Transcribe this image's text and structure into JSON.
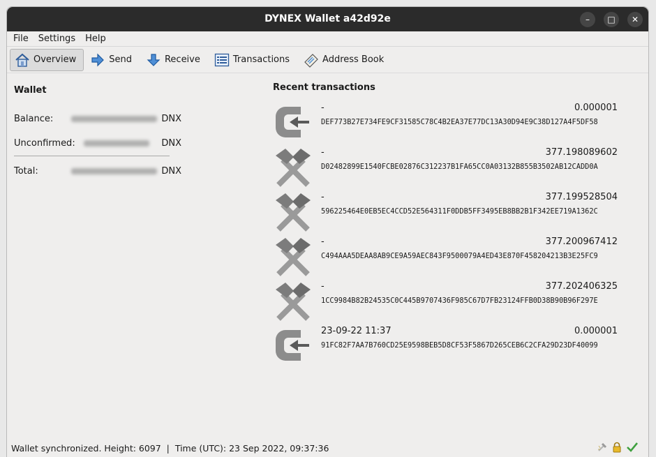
{
  "window": {
    "title": "DYNEX Wallet a42d92e",
    "controls": [
      "–",
      "□",
      "✕"
    ]
  },
  "menu": {
    "items": [
      "File",
      "Settings",
      "Help"
    ]
  },
  "toolbar": {
    "items": [
      {
        "label": "Overview",
        "icon": "home-icon",
        "active": true
      },
      {
        "label": "Send",
        "icon": "send-arrow-icon",
        "active": false
      },
      {
        "label": "Receive",
        "icon": "receive-arrow-icon",
        "active": false
      },
      {
        "label": "Transactions",
        "icon": "list-icon",
        "active": false
      },
      {
        "label": "Address Book",
        "icon": "address-book-icon",
        "active": false
      }
    ]
  },
  "wallet": {
    "heading": "Wallet",
    "balance_label": "Balance:",
    "unconfirmed_label": "Unconfirmed:",
    "total_label": "Total:",
    "unit": "DNX"
  },
  "recent": {
    "heading": "Recent transactions",
    "transactions": [
      {
        "type": "incoming",
        "icon": "incoming-icon",
        "date": "-",
        "amount": "0.000001",
        "hash": "DEF773B27E734FE9CF31585C78C4B2EA37E77DC13A30D94E9C38D127A4F5DF58"
      },
      {
        "type": "mined",
        "icon": "mining-icon",
        "date": "-",
        "amount": "377.198089602",
        "hash": "D02482899E1540FCBE02876C312237B1FA65CC0A03132B855B3502AB12CADD0A"
      },
      {
        "type": "mined",
        "icon": "mining-icon",
        "date": "-",
        "amount": "377.199528504",
        "hash": "596225464E0EB5EC4CCD52E564311F0DDB5FF3495EB8BB2B1F342EE719A1362C"
      },
      {
        "type": "mined",
        "icon": "mining-icon",
        "date": "-",
        "amount": "377.200967412",
        "hash": "C494AAA5DEAA8AB9CE9A59AEC843F9500079A4ED43E870F458204213B3E25FC9"
      },
      {
        "type": "mined",
        "icon": "mining-icon",
        "date": "-",
        "amount": "377.202406325",
        "hash": "1CC9984B82B24535C0C445B9707436F985C67D7FB23124FFB0D38B90B96F297E"
      },
      {
        "type": "incoming",
        "icon": "incoming-icon",
        "date": "23-09-22 11:37",
        "amount": "0.000001",
        "hash": "91FC82F7AA7B760CD25E9598BEB5D8CF53F5867D265CEB6C2CFA29D23DF40099"
      }
    ]
  },
  "status": {
    "text": "Wallet synchronized. Height: 6097  |  Time (UTC): 23 Sep 2022, 09:37:36",
    "icons": [
      "mining-status-icon",
      "lock-icon",
      "synced-check-icon"
    ]
  },
  "colors": {
    "titlebar": "#2b2b2b",
    "window_bg": "#efeeed",
    "icon_gray": "#8a8a8a",
    "check_green": "#3fa03f"
  }
}
